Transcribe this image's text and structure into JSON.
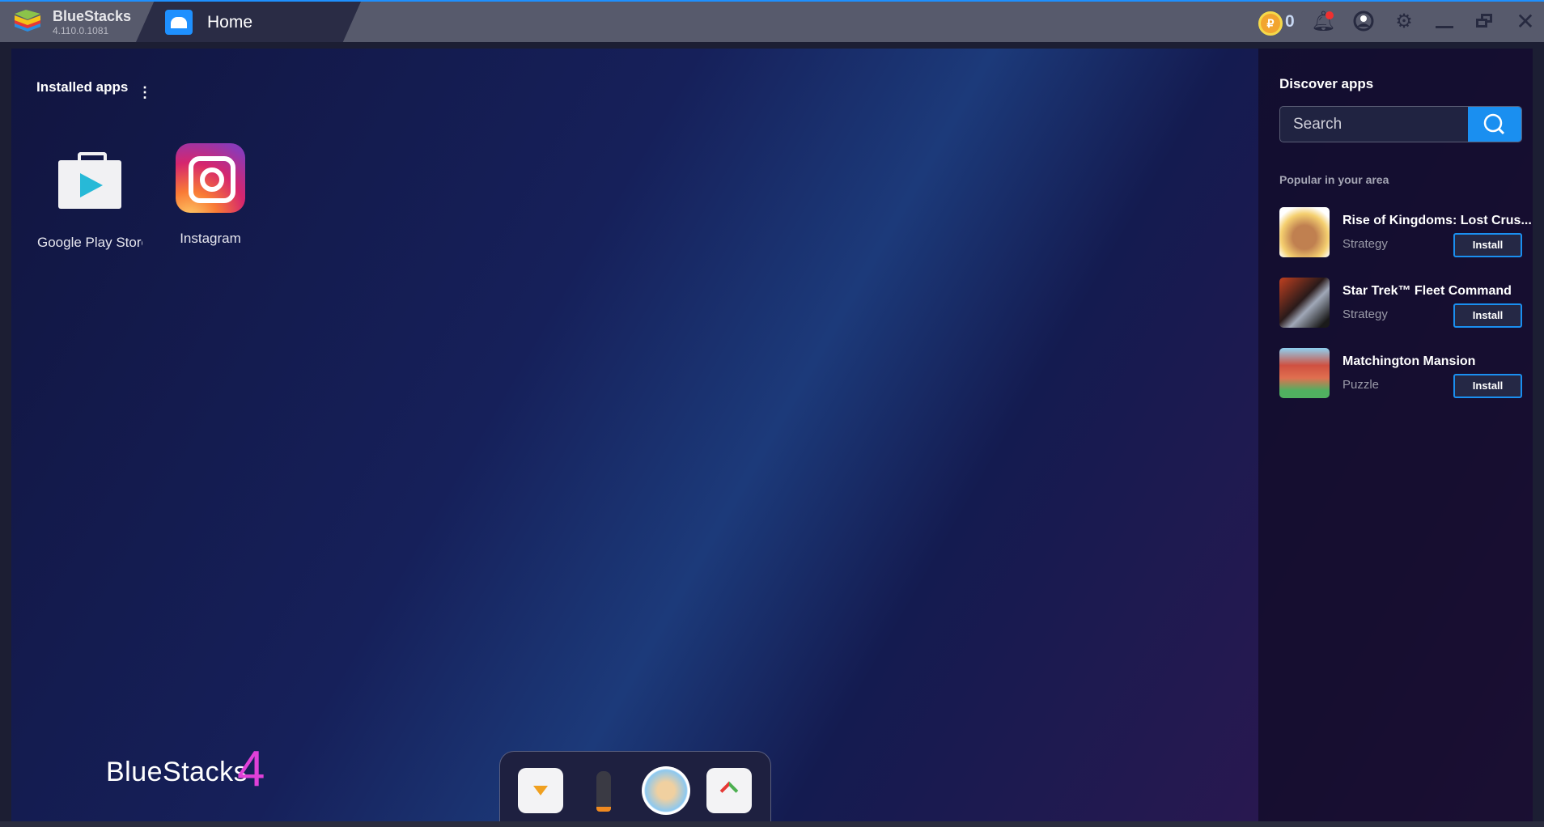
{
  "titlebar": {
    "app_name": "BlueStacks",
    "version": "4.110.0.1081",
    "tab_label": "Home",
    "coins": "0",
    "coin_symbol": "₽"
  },
  "installed": {
    "title": "Installed apps",
    "apps": [
      {
        "label": "Google Play Store"
      },
      {
        "label": "Instagram"
      }
    ]
  },
  "discover": {
    "title": "Discover apps",
    "search_placeholder": "Search",
    "popular_title": "Popular in your area",
    "items": [
      {
        "name": "Rise of Kingdoms: Lost Crus...",
        "category": "Strategy",
        "button": "Install"
      },
      {
        "name": "Star Trek™ Fleet Command",
        "category": "Strategy",
        "button": "Install"
      },
      {
        "name": "Matchington Mansion",
        "category": "Puzzle",
        "button": "Install"
      }
    ]
  },
  "brand": {
    "text": "BlueStacks",
    "version_mark": "4"
  },
  "colors": {
    "accent": "#1a8ff0",
    "titlebar": "#575a6c"
  }
}
